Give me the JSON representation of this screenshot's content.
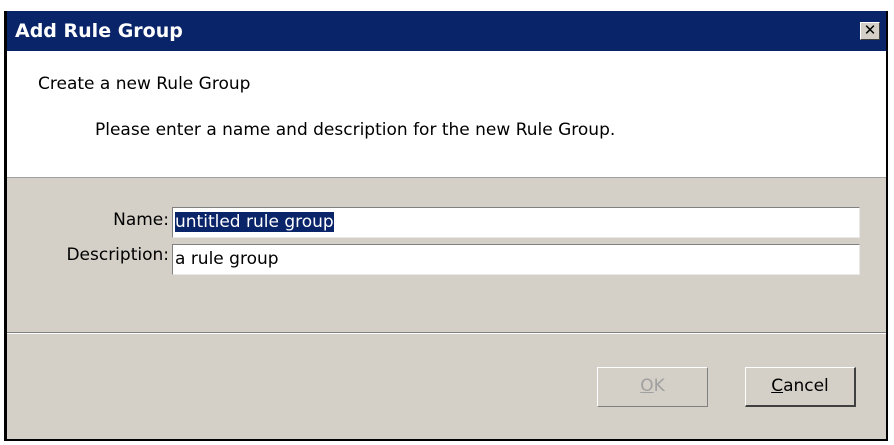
{
  "window": {
    "title": "Add Rule Group",
    "close_symbol": "✕"
  },
  "header": {
    "title": "Create a new Rule Group",
    "description": "Please enter a name and description for the new Rule Group."
  },
  "form": {
    "name_label": "Name:",
    "name_value": "untitled rule group",
    "description_label": "Description:",
    "description_value": "a rule group"
  },
  "buttons": {
    "ok_label": "OK",
    "ok_enabled": false,
    "cancel_label": "Cancel"
  },
  "colors": {
    "titlebar": "#0a246a",
    "dialog_face": "#d4d0c8",
    "selection": "#0a246a"
  }
}
